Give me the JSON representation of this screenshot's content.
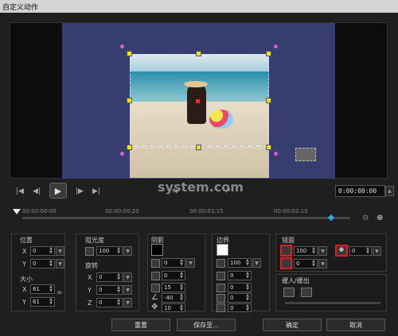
{
  "title": "自定义动作",
  "timecode": "0:00:00:00",
  "ruler_ticks": [
    "00:00:00:00",
    "00:00:00:20",
    "00:00:01:15",
    "00:00:02:10"
  ],
  "watermark": "system.com",
  "position": {
    "label": "位置",
    "x_label": "X",
    "x": "0",
    "y_label": "Y",
    "y": "0"
  },
  "size": {
    "label": "大小",
    "x_label": "X",
    "x": "61",
    "y_label": "Y",
    "y": "61"
  },
  "opacity": {
    "label": "阻光度",
    "value": "100"
  },
  "rotation": {
    "label": "旋转",
    "x_label": "X",
    "x": "0",
    "y_label": "Y",
    "y": "0",
    "z_label": "Z",
    "z": "0"
  },
  "shadow": {
    "label": "阴影",
    "v1": "0",
    "v2": "0",
    "v3": "15",
    "v4": "-40",
    "v5": "10"
  },
  "border": {
    "label": "边界",
    "v1": "100",
    "v2": "0",
    "v3": "0",
    "v4": "0",
    "v5": "0"
  },
  "mirror": {
    "label": "镜面",
    "v1": "100",
    "v2": "0",
    "v3": "0"
  },
  "fade": {
    "label": "缓入/缓出"
  },
  "buttons": {
    "reset": "重置",
    "save_to": "保存至...",
    "ok": "确定",
    "cancel": "取消"
  },
  "colors": {
    "canvas": "#373e6f",
    "accent_red": "#e02020",
    "handle": "#f2e600"
  }
}
